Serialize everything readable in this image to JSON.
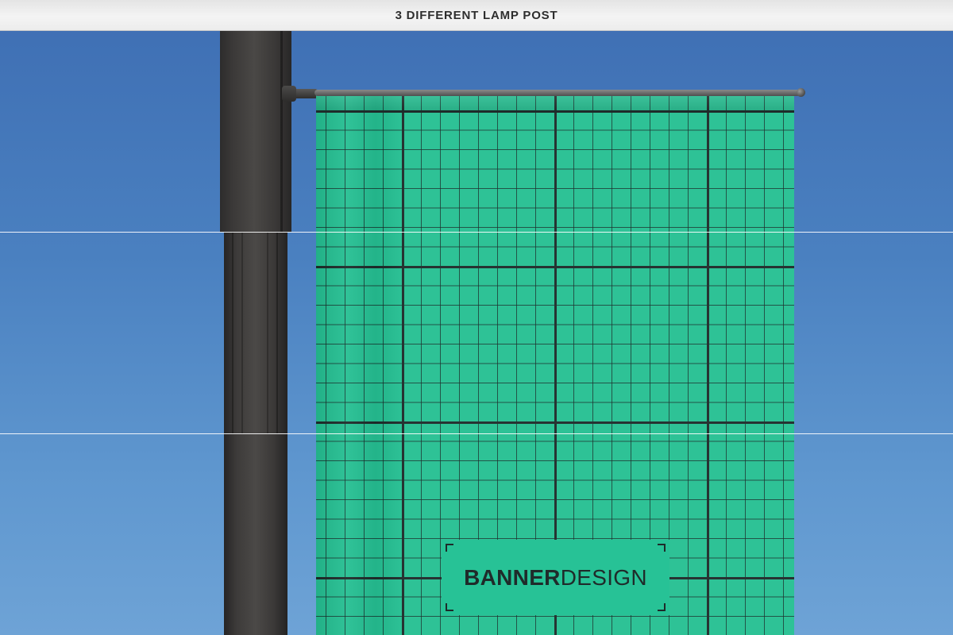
{
  "header": {
    "title": "3 DIFFERENT LAMP POST"
  },
  "banner": {
    "label_bold": "BANNER",
    "label_regular": "DESIGN"
  },
  "colors": {
    "sky_top": "#3e6eb3",
    "sky_bottom": "#6ea3d6",
    "banner_green": "#25bf92",
    "grid_lines": "#1e2b2a",
    "pole": "#3b3938"
  }
}
